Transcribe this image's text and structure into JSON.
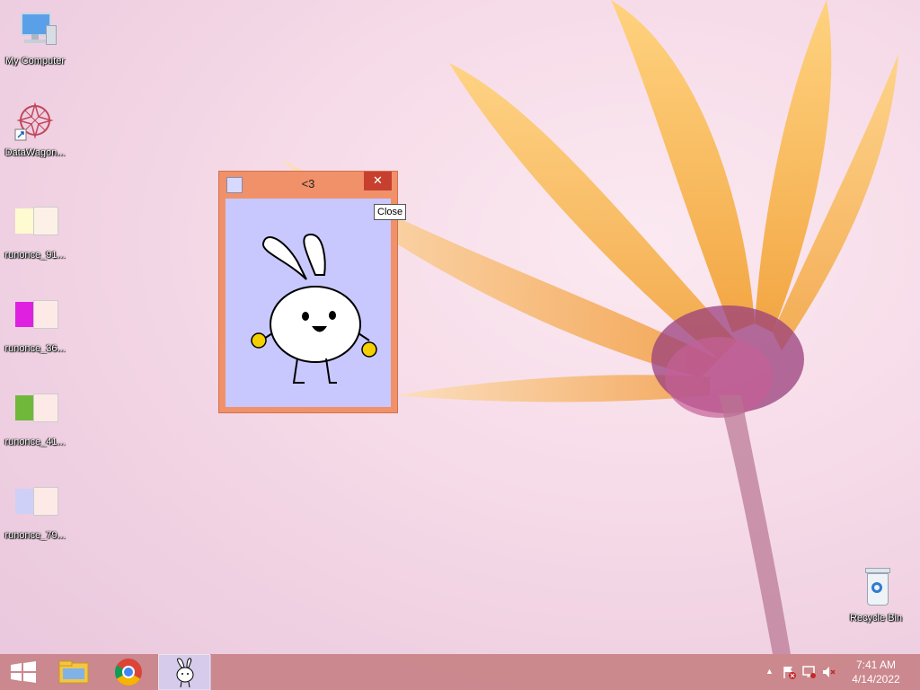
{
  "desktop": {
    "icons": [
      {
        "label": "My Computer",
        "icon": "computer-icon"
      },
      {
        "label": "DataWagon...",
        "icon": "datawagon-shortcut-icon"
      },
      {
        "label": "runonce_91...",
        "icon": "runonce-image-icon"
      },
      {
        "label": "runonce_36...",
        "icon": "runonce-image-icon"
      },
      {
        "label": "runonce_41...",
        "icon": "runonce-image-icon"
      },
      {
        "label": "runonce_79...",
        "icon": "runonce-image-icon"
      },
      {
        "label": "Recycle Bin",
        "icon": "recycle-bin-icon"
      }
    ]
  },
  "window": {
    "title": "<3",
    "close_glyph": "✕",
    "client_bg": "#c8c8ff",
    "frame_color": "#f0916a"
  },
  "tooltip": {
    "text": "Close"
  },
  "taskbar": {
    "start_icon": "windows-start-icon",
    "pinned": [
      "file-explorer-icon",
      "chrome-icon",
      "bunny-app-icon"
    ],
    "tray": {
      "show_hidden_glyph": "▲",
      "icons": [
        "action-center-flag-icon",
        "network-icon",
        "volume-muted-icon"
      ],
      "time": "7:41 AM",
      "date": "4/14/2022"
    }
  }
}
